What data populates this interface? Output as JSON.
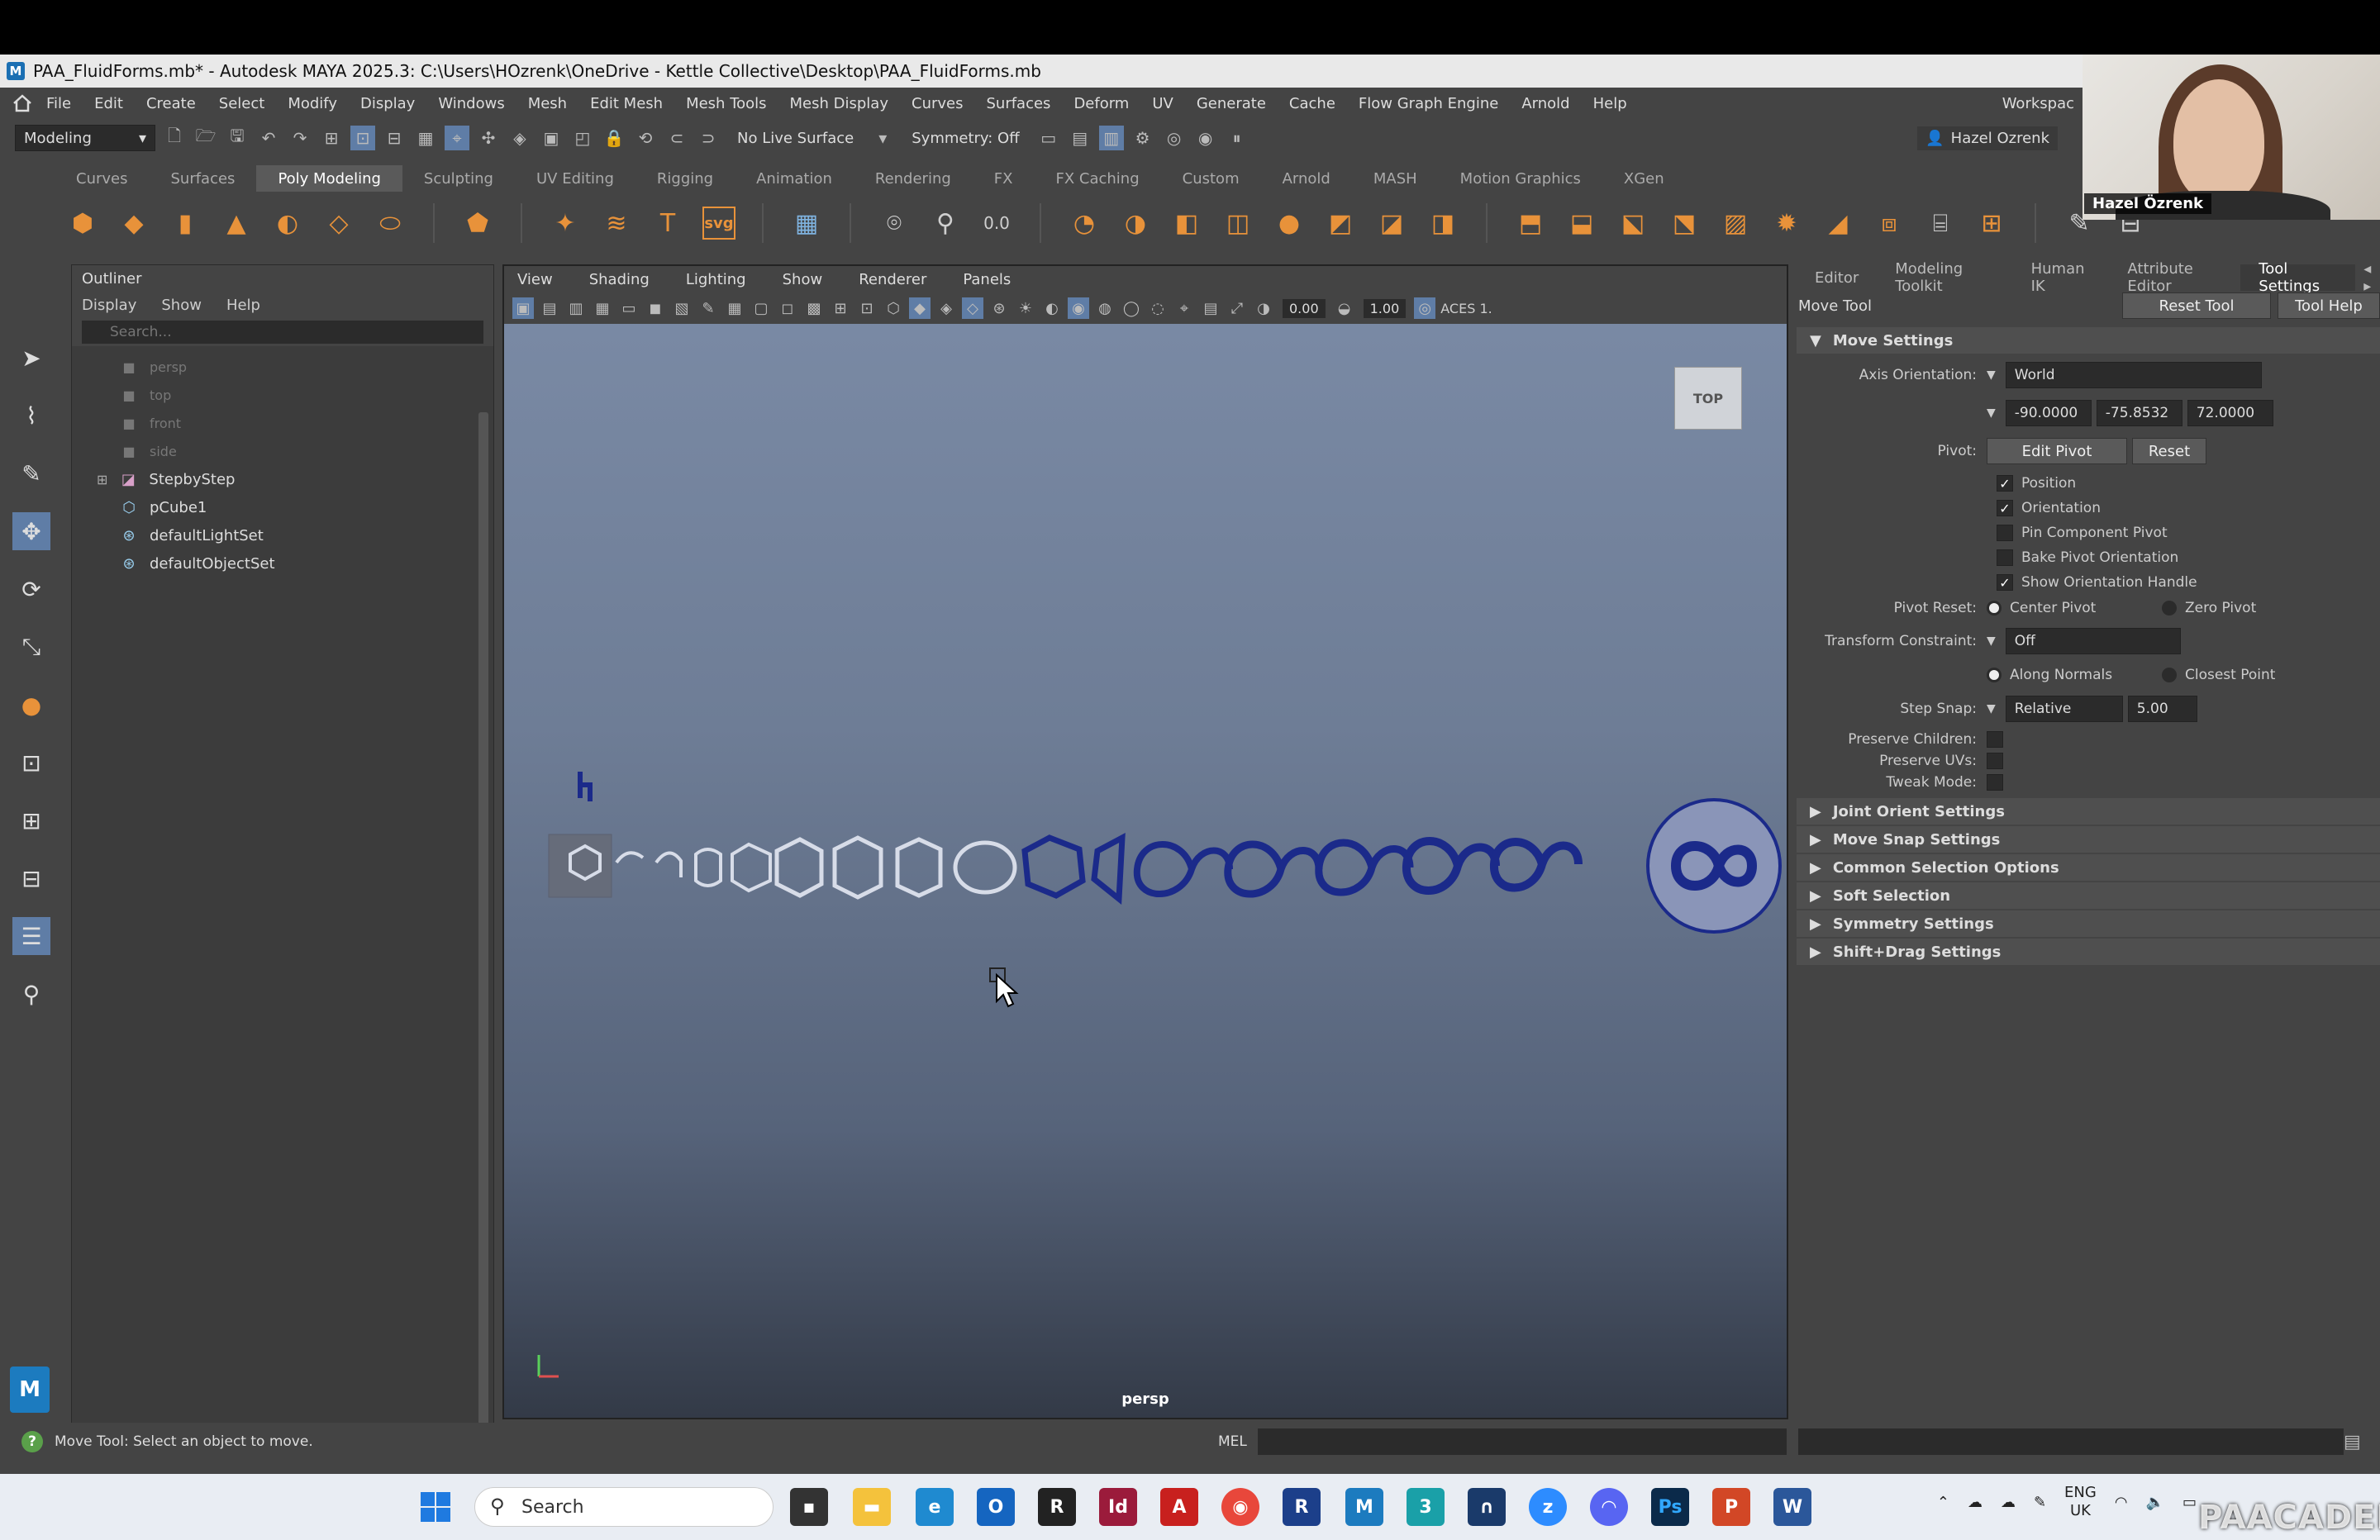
{
  "window": {
    "title": "PAA_FluidForms.mb* - Autodesk MAYA 2025.3: C:\\Users\\HOzrenk\\OneDrive - Kettle Collective\\Desktop\\PAA_FluidForms.mb"
  },
  "menubar": {
    "items": [
      "File",
      "Edit",
      "Create",
      "Select",
      "Modify",
      "Display",
      "Windows",
      "Mesh",
      "Edit Mesh",
      "Mesh Tools",
      "Mesh Display",
      "Curves",
      "Surfaces",
      "Deform",
      "UV",
      "Generate",
      "Cache",
      "Flow Graph Engine",
      "Arnold",
      "Help"
    ],
    "workspace": "Workspac"
  },
  "statusline": {
    "mode": "Modeling",
    "live_surface": "No Live Surface",
    "symmetry": "Symmetry: Off",
    "user": "Hazel Ozrenk"
  },
  "shelf": {
    "tabs": [
      "Curves",
      "Surfaces",
      "Poly Modeling",
      "Sculpting",
      "UV Editing",
      "Rigging",
      "Animation",
      "Rendering",
      "FX",
      "FX Caching",
      "Custom",
      "Arnold",
      "MASH",
      "Motion Graphics",
      "XGen"
    ],
    "active_tab": "Poly Modeling",
    "svg_label": "svg",
    "num_label": "0.0"
  },
  "outliner": {
    "title": "Outliner",
    "menu": [
      "Display",
      "Show",
      "Help"
    ],
    "search_placeholder": "Search...",
    "items": [
      {
        "label": "persp",
        "dim": true
      },
      {
        "label": "top",
        "dim": true
      },
      {
        "label": "front",
        "dim": true
      },
      {
        "label": "side",
        "dim": true
      },
      {
        "label": "StepbyStep",
        "dim": false
      },
      {
        "label": "pCube1",
        "dim": false
      },
      {
        "label": "defaultLightSet",
        "dim": false
      },
      {
        "label": "defaultObjectSet",
        "dim": false
      }
    ]
  },
  "viewport": {
    "menu": [
      "View",
      "Shading",
      "Lighting",
      "Show",
      "Renderer",
      "Panels"
    ],
    "exposure": "0.00",
    "gamma": "1.00",
    "colorspace": "ACES 1.",
    "viewcube": "TOP",
    "camera": "persp"
  },
  "rightpanel": {
    "tabs": [
      "Editor",
      "Modeling Toolkit",
      "Human IK",
      "Attribute Editor",
      "Tool Settings"
    ],
    "active_tab": "Tool Settings",
    "tool_name": "Move Tool",
    "reset_tool": "Reset Tool",
    "tool_help": "Tool Help",
    "move_settings": "Move Settings",
    "axis_orientation_label": "Axis Orientation:",
    "axis_orientation_value": "World",
    "axis_values": [
      "-90.0000",
      "-75.8532",
      "72.0000"
    ],
    "pivot_label": "Pivot:",
    "edit_pivot": "Edit Pivot",
    "reset": "Reset",
    "checks": [
      {
        "label": "Position",
        "checked": true
      },
      {
        "label": "Orientation",
        "checked": true
      },
      {
        "label": "Pin Component Pivot",
        "checked": false
      },
      {
        "label": "Bake Pivot Orientation",
        "checked": false
      },
      {
        "label": "Show Orientation Handle",
        "checked": true
      }
    ],
    "pivot_reset_label": "Pivot Reset:",
    "center_pivot": "Center Pivot",
    "zero_pivot": "Zero Pivot",
    "transform_constraint_label": "Transform Constraint:",
    "transform_constraint_value": "Off",
    "along_normals": "Along Normals",
    "closest_point": "Closest Point",
    "step_snap_label": "Step Snap:",
    "step_snap_value": "Relative",
    "step_snap_amount": "5.00",
    "preserve_children": "Preserve Children:",
    "preserve_uvs": "Preserve UVs:",
    "tweak_mode": "Tweak Mode:",
    "collapsed_sections": [
      "Joint Orient Settings",
      "Move Snap Settings",
      "Common Selection Options",
      "Soft Selection",
      "Symmetry Settings",
      "Shift+Drag Settings"
    ]
  },
  "helpline": {
    "message": "Move Tool: Select an object to move.",
    "mel_label": "MEL"
  },
  "taskbar": {
    "search_label": "Search",
    "lang_top": "ENG",
    "lang_bottom": "UK"
  },
  "webcam": {
    "name": "Hazel Özrenk"
  },
  "watermark": "PAACADEMY",
  "colors": {
    "maya_blue": "#1a6fb3",
    "mesh_blue": "#1b2a8a",
    "active_highlight": "#5f7da6"
  }
}
